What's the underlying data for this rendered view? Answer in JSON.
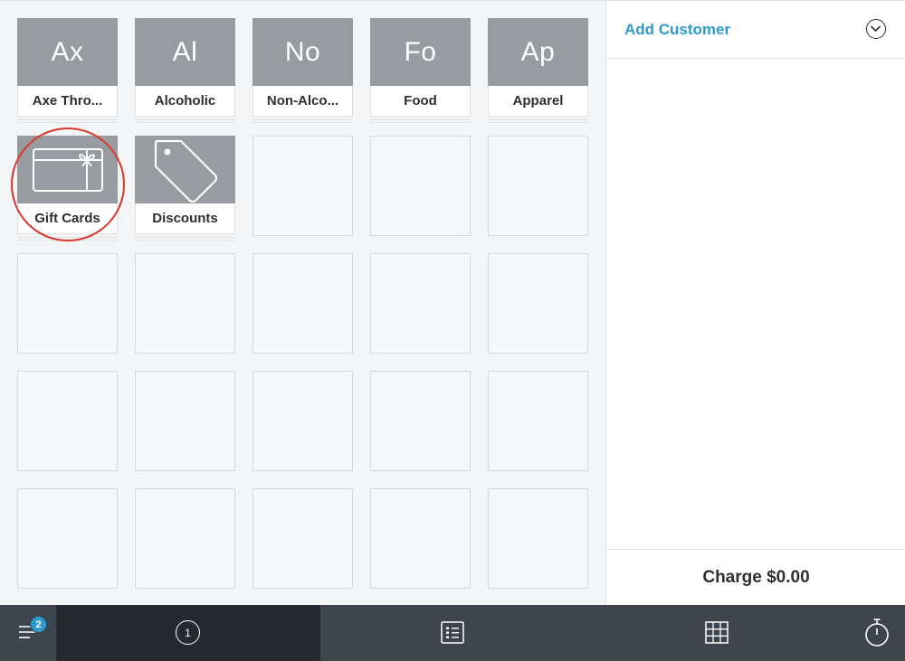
{
  "categories": [
    {
      "abbr": "Ax",
      "label": "Axe Thro..."
    },
    {
      "abbr": "Al",
      "label": "Alcoholic"
    },
    {
      "abbr": "No",
      "label": "Non-Alco..."
    },
    {
      "abbr": "Fo",
      "label": "Food"
    },
    {
      "abbr": "Ap",
      "label": "Apparel"
    }
  ],
  "special_tiles": [
    {
      "icon": "gift-card-icon",
      "label": "Gift Cards"
    },
    {
      "icon": "tag-icon",
      "label": "Discounts"
    }
  ],
  "customer": {
    "add_label": "Add Customer"
  },
  "charge": {
    "label": "Charge $0.00"
  },
  "bottom_nav": {
    "open_tickets_badge": "2",
    "keypad_number": "1",
    "icons": [
      "menu-icon",
      "keypad-icon",
      "library-icon",
      "grid-icon",
      "timer-icon"
    ]
  },
  "colors": {
    "accent": "#2d9ad0",
    "tile": "#989b9f",
    "bar": "#3d454e",
    "bar_active": "#242a30",
    "highlight": "#d8382b"
  }
}
